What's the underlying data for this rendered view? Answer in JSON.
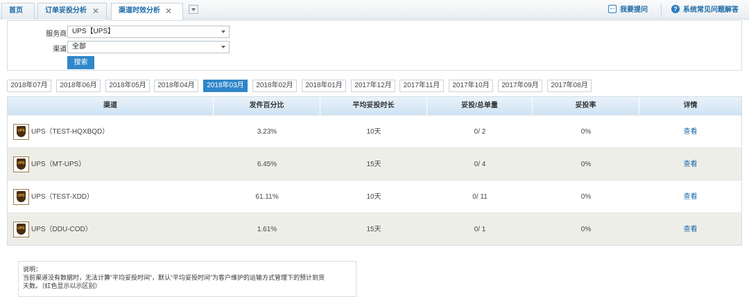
{
  "tabs": {
    "home": "首页",
    "order_complaint": "订单妥投分析",
    "channel_timing": "渠道时效分析"
  },
  "top_links": {
    "ask": "我要提问",
    "faq": "系统常见问题解答"
  },
  "filter": {
    "provider_label": "服务商:",
    "provider_value": "UPS【UPS】",
    "channel_label": "渠道:",
    "channel_value": "全部",
    "search_label": "搜索"
  },
  "months": [
    "2018年07月",
    "2018年06月",
    "2018年05月",
    "2018年04月",
    "2018年03月",
    "2018年02月",
    "2018年01月",
    "2017年12月",
    "2017年11月",
    "2017年10月",
    "2017年09月",
    "2017年08月"
  ],
  "active_month_index": 4,
  "table": {
    "headers": [
      "渠道",
      "发件百分比",
      "平均妥投时长",
      "妥投/总单量",
      "妥投率",
      "详情"
    ],
    "rows": [
      {
        "logo": "UPS",
        "channel": "UPS（TEST-HQXBQD）",
        "percent": "3.23%",
        "avg": "10天",
        "ratio": "0/ 2",
        "rate": "0%",
        "detail": "查看"
      },
      {
        "logo": "UPS",
        "channel": "UPS（MT-UPS）",
        "percent": "6.45%",
        "avg": "15天",
        "ratio": "0/ 4",
        "rate": "0%",
        "detail": "查看"
      },
      {
        "logo": "UPS",
        "channel": "UPS（TEST-XDD）",
        "percent": "61.11%",
        "avg": "10天",
        "ratio": "0/ 11",
        "rate": "0%",
        "detail": "查看"
      },
      {
        "logo": "UPS",
        "channel": "UPS（DDU-COD）",
        "percent": "1.61%",
        "avg": "15天",
        "ratio": "0/ 1",
        "rate": "0%",
        "detail": "查看"
      }
    ]
  },
  "note": {
    "title": "说明：",
    "line1": "当前渠道没有数据时，无法计算“平均妥投时间”，默认“平均妥投时间”为客户维护的运输方式管理下的预计到货",
    "line2": "天数。（红色显示以示区别）"
  },
  "colors": {
    "accent": "#2f86c9",
    "link": "#1b6aa8",
    "alt_row": "#eeeee8"
  }
}
